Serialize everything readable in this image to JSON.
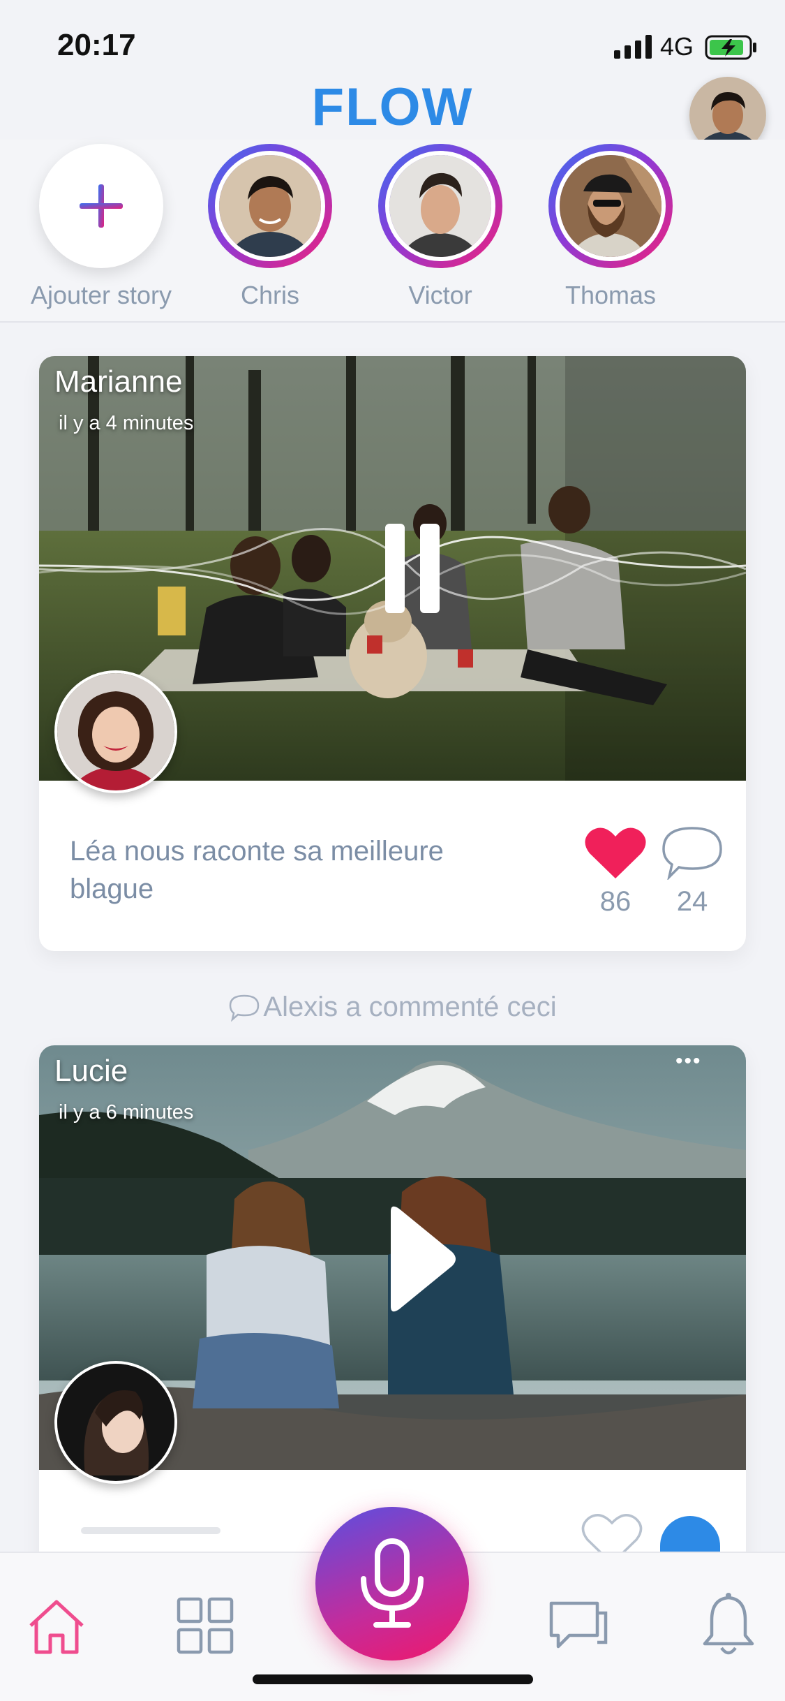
{
  "status": {
    "time": "20:17",
    "network": "4G"
  },
  "header": {
    "title": "FLOW"
  },
  "stories": [
    {
      "name": "Ajouter story",
      "type": "add"
    },
    {
      "name": "Chris"
    },
    {
      "name": "Victor"
    },
    {
      "name": "Thomas"
    }
  ],
  "posts": [
    {
      "author": "Marianne",
      "time_ago": "il y a 4 minutes",
      "caption": "Léa nous raconte sa meilleure blague",
      "likes": "86",
      "comments": "24",
      "state": "playing"
    },
    {
      "author": "Lucie",
      "time_ago": "il y a 6 minutes",
      "state": "paused",
      "more": "•••"
    }
  ],
  "activity": {
    "comment_note": "Alexis a commenté ceci"
  },
  "colors": {
    "brand": "#2d8ae6",
    "like": "#f0205a",
    "gradient_start": "#3a6ff0",
    "gradient_end": "#f0207a",
    "muted_text": "#8a9aae"
  },
  "nav": {
    "items": [
      "home-icon",
      "grid-icon",
      "mic-icon",
      "chat-icon",
      "bell-icon"
    ],
    "active": "home-icon"
  }
}
